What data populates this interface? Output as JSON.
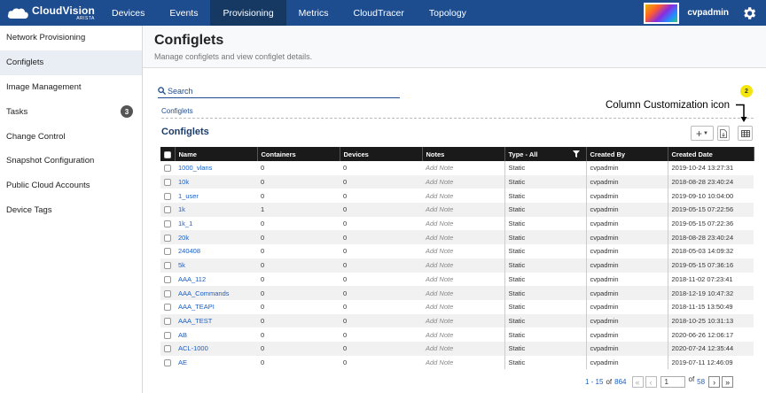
{
  "app": {
    "logo_name": "CloudVision",
    "logo_sub": "ARISTA",
    "nav": [
      "Devices",
      "Events",
      "Provisioning",
      "Metrics",
      "CloudTracer",
      "Topology"
    ],
    "active_nav": "Provisioning",
    "username": "cvpadmin"
  },
  "sidebar": {
    "items": [
      {
        "label": "Network Provisioning"
      },
      {
        "label": "Configlets"
      },
      {
        "label": "Image Management"
      },
      {
        "label": "Tasks",
        "badge": "3"
      },
      {
        "label": "Change Control"
      },
      {
        "label": "Snapshot Configuration"
      },
      {
        "label": "Public Cloud Accounts"
      },
      {
        "label": "Device Tags"
      }
    ],
    "active": "Configlets"
  },
  "page": {
    "title": "Configlets",
    "subtitle": "Manage configlets and view configlet details.",
    "search_placeholder": "Search",
    "breadcrumb": "Configlets",
    "table_title": "Configlets"
  },
  "callout": {
    "number": "2",
    "text": "Column Customization icon"
  },
  "table": {
    "columns": [
      "Name",
      "Containers",
      "Devices",
      "Notes",
      "Type - All",
      "Created By",
      "Created Date"
    ],
    "rows": [
      {
        "name": "1000_vlans",
        "containers": "0",
        "devices": "0",
        "notes": "Add Note",
        "type": "Static",
        "created_by": "cvpadmin",
        "created_date": "2019-10-24 13:27:31"
      },
      {
        "name": "10k",
        "containers": "0",
        "devices": "0",
        "notes": "Add Note",
        "type": "Static",
        "created_by": "cvpadmin",
        "created_date": "2018-08-28 23:40:24"
      },
      {
        "name": "1_user",
        "containers": "0",
        "devices": "0",
        "notes": "Add Note",
        "type": "Static",
        "created_by": "cvpadmin",
        "created_date": "2019-09-10 10:04:00"
      },
      {
        "name": "1k",
        "containers": "1",
        "devices": "0",
        "notes": "Add Note",
        "type": "Static",
        "created_by": "cvpadmin",
        "created_date": "2019-05-15 07:22:56"
      },
      {
        "name": "1k_1",
        "containers": "0",
        "devices": "0",
        "notes": "Add Note",
        "type": "Static",
        "created_by": "cvpadmin",
        "created_date": "2019-05-15 07:22:36"
      },
      {
        "name": "20k",
        "containers": "0",
        "devices": "0",
        "notes": "Add Note",
        "type": "Static",
        "created_by": "cvpadmin",
        "created_date": "2018-08-28 23:40:24"
      },
      {
        "name": "240408",
        "containers": "0",
        "devices": "0",
        "notes": "Add Note",
        "type": "Static",
        "created_by": "cvpadmin",
        "created_date": "2018-05-03 14:09:32"
      },
      {
        "name": "5k",
        "containers": "0",
        "devices": "0",
        "notes": "Add Note",
        "type": "Static",
        "created_by": "cvpadmin",
        "created_date": "2019-05-15 07:36:16"
      },
      {
        "name": "AAA_112",
        "containers": "0",
        "devices": "0",
        "notes": "Add Note",
        "type": "Static",
        "created_by": "cvpadmin",
        "created_date": "2018-11-02 07:23:41"
      },
      {
        "name": "AAA_Commands",
        "containers": "0",
        "devices": "0",
        "notes": "Add Note",
        "type": "Static",
        "created_by": "cvpadmin",
        "created_date": "2018-12-19 10:47:32"
      },
      {
        "name": "AAA_TEAPI",
        "containers": "0",
        "devices": "0",
        "notes": "Add Note",
        "type": "Static",
        "created_by": "cvpadmin",
        "created_date": "2018-11-15 13:50:49"
      },
      {
        "name": "AAA_TEST",
        "containers": "0",
        "devices": "0",
        "notes": "Add Note",
        "type": "Static",
        "created_by": "cvpadmin",
        "created_date": "2018-10-25 10:31:13"
      },
      {
        "name": "AB",
        "containers": "0",
        "devices": "0",
        "notes": "Add Note",
        "type": "Static",
        "created_by": "cvpadmin",
        "created_date": "2020-06-26 12:06:17"
      },
      {
        "name": "ACL-1000",
        "containers": "0",
        "devices": "0",
        "notes": "Add Note",
        "type": "Static",
        "created_by": "cvpadmin",
        "created_date": "2020-07-24 12:35:44"
      },
      {
        "name": "AE",
        "containers": "0",
        "devices": "0",
        "notes": "Add Note",
        "type": "Static",
        "created_by": "cvpadmin",
        "created_date": "2019-07-11 12:46:09"
      }
    ]
  },
  "pagination": {
    "range": "1 - 15",
    "of_label": "of",
    "total": "864",
    "current_page": "1",
    "total_pages": "58"
  },
  "colors": {
    "nav_bg": "#1d4c8f",
    "nav_active": "#163963",
    "link": "#1a5ec2",
    "table_header": "#1a1a1a",
    "callout": "#f5e50e"
  }
}
